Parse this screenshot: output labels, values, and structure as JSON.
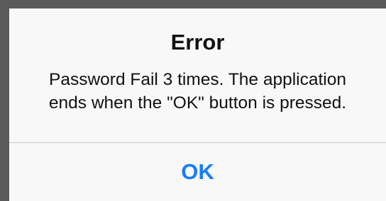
{
  "alert": {
    "title": "Error",
    "message_line1": "Password Fail 3 times. The application",
    "message_line2": "ends when the \"OK\" button is pressed.",
    "ok_label": "OK"
  },
  "colors": {
    "backdrop": "#5a5a5a",
    "dialog_background": "#f8f8f8",
    "text": "#111111",
    "divider": "#c8c8cc",
    "button_accent": "#147efb"
  }
}
